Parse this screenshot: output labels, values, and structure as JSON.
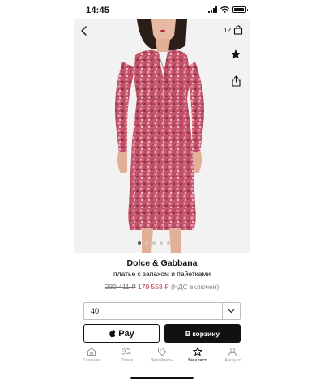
{
  "status_bar": {
    "time": "14:45",
    "battery_level": 0.9
  },
  "product": {
    "image_icon": "sequin-dress-photo",
    "brand": "Dolce & Gabbana",
    "name": "платье с запахом и пайетками",
    "old_price": "239 411 ₽",
    "new_price": "179 558 ₽",
    "vat_note": "(НДС включен)",
    "image_count": 5,
    "active_image": 1
  },
  "top_actions": {
    "back_icon": "chevron-left-icon",
    "cart_count": "12",
    "cart_icon": "shopping-bag-icon",
    "favorite_icon": "star-icon",
    "share_icon": "share-icon"
  },
  "size": {
    "value": "40",
    "icon": "chevron-down-icon"
  },
  "buttons": {
    "apple_pay": "Pay",
    "add_to_cart": "В корзину"
  },
  "tabs": [
    {
      "label": "Главная",
      "icon": "home-icon",
      "active": false
    },
    {
      "label": "Поиск",
      "icon": "search-icon",
      "active": false
    },
    {
      "label": "Дизайнеры",
      "icon": "tag-icon",
      "active": false
    },
    {
      "label": "Вишлист",
      "icon": "star-icon",
      "active": true
    },
    {
      "label": "Аккаунт",
      "icon": "person-icon",
      "active": false
    }
  ],
  "colors": {
    "accent_price": "#c7374a",
    "primary_button": "#111111",
    "dress": "#c4546a"
  }
}
